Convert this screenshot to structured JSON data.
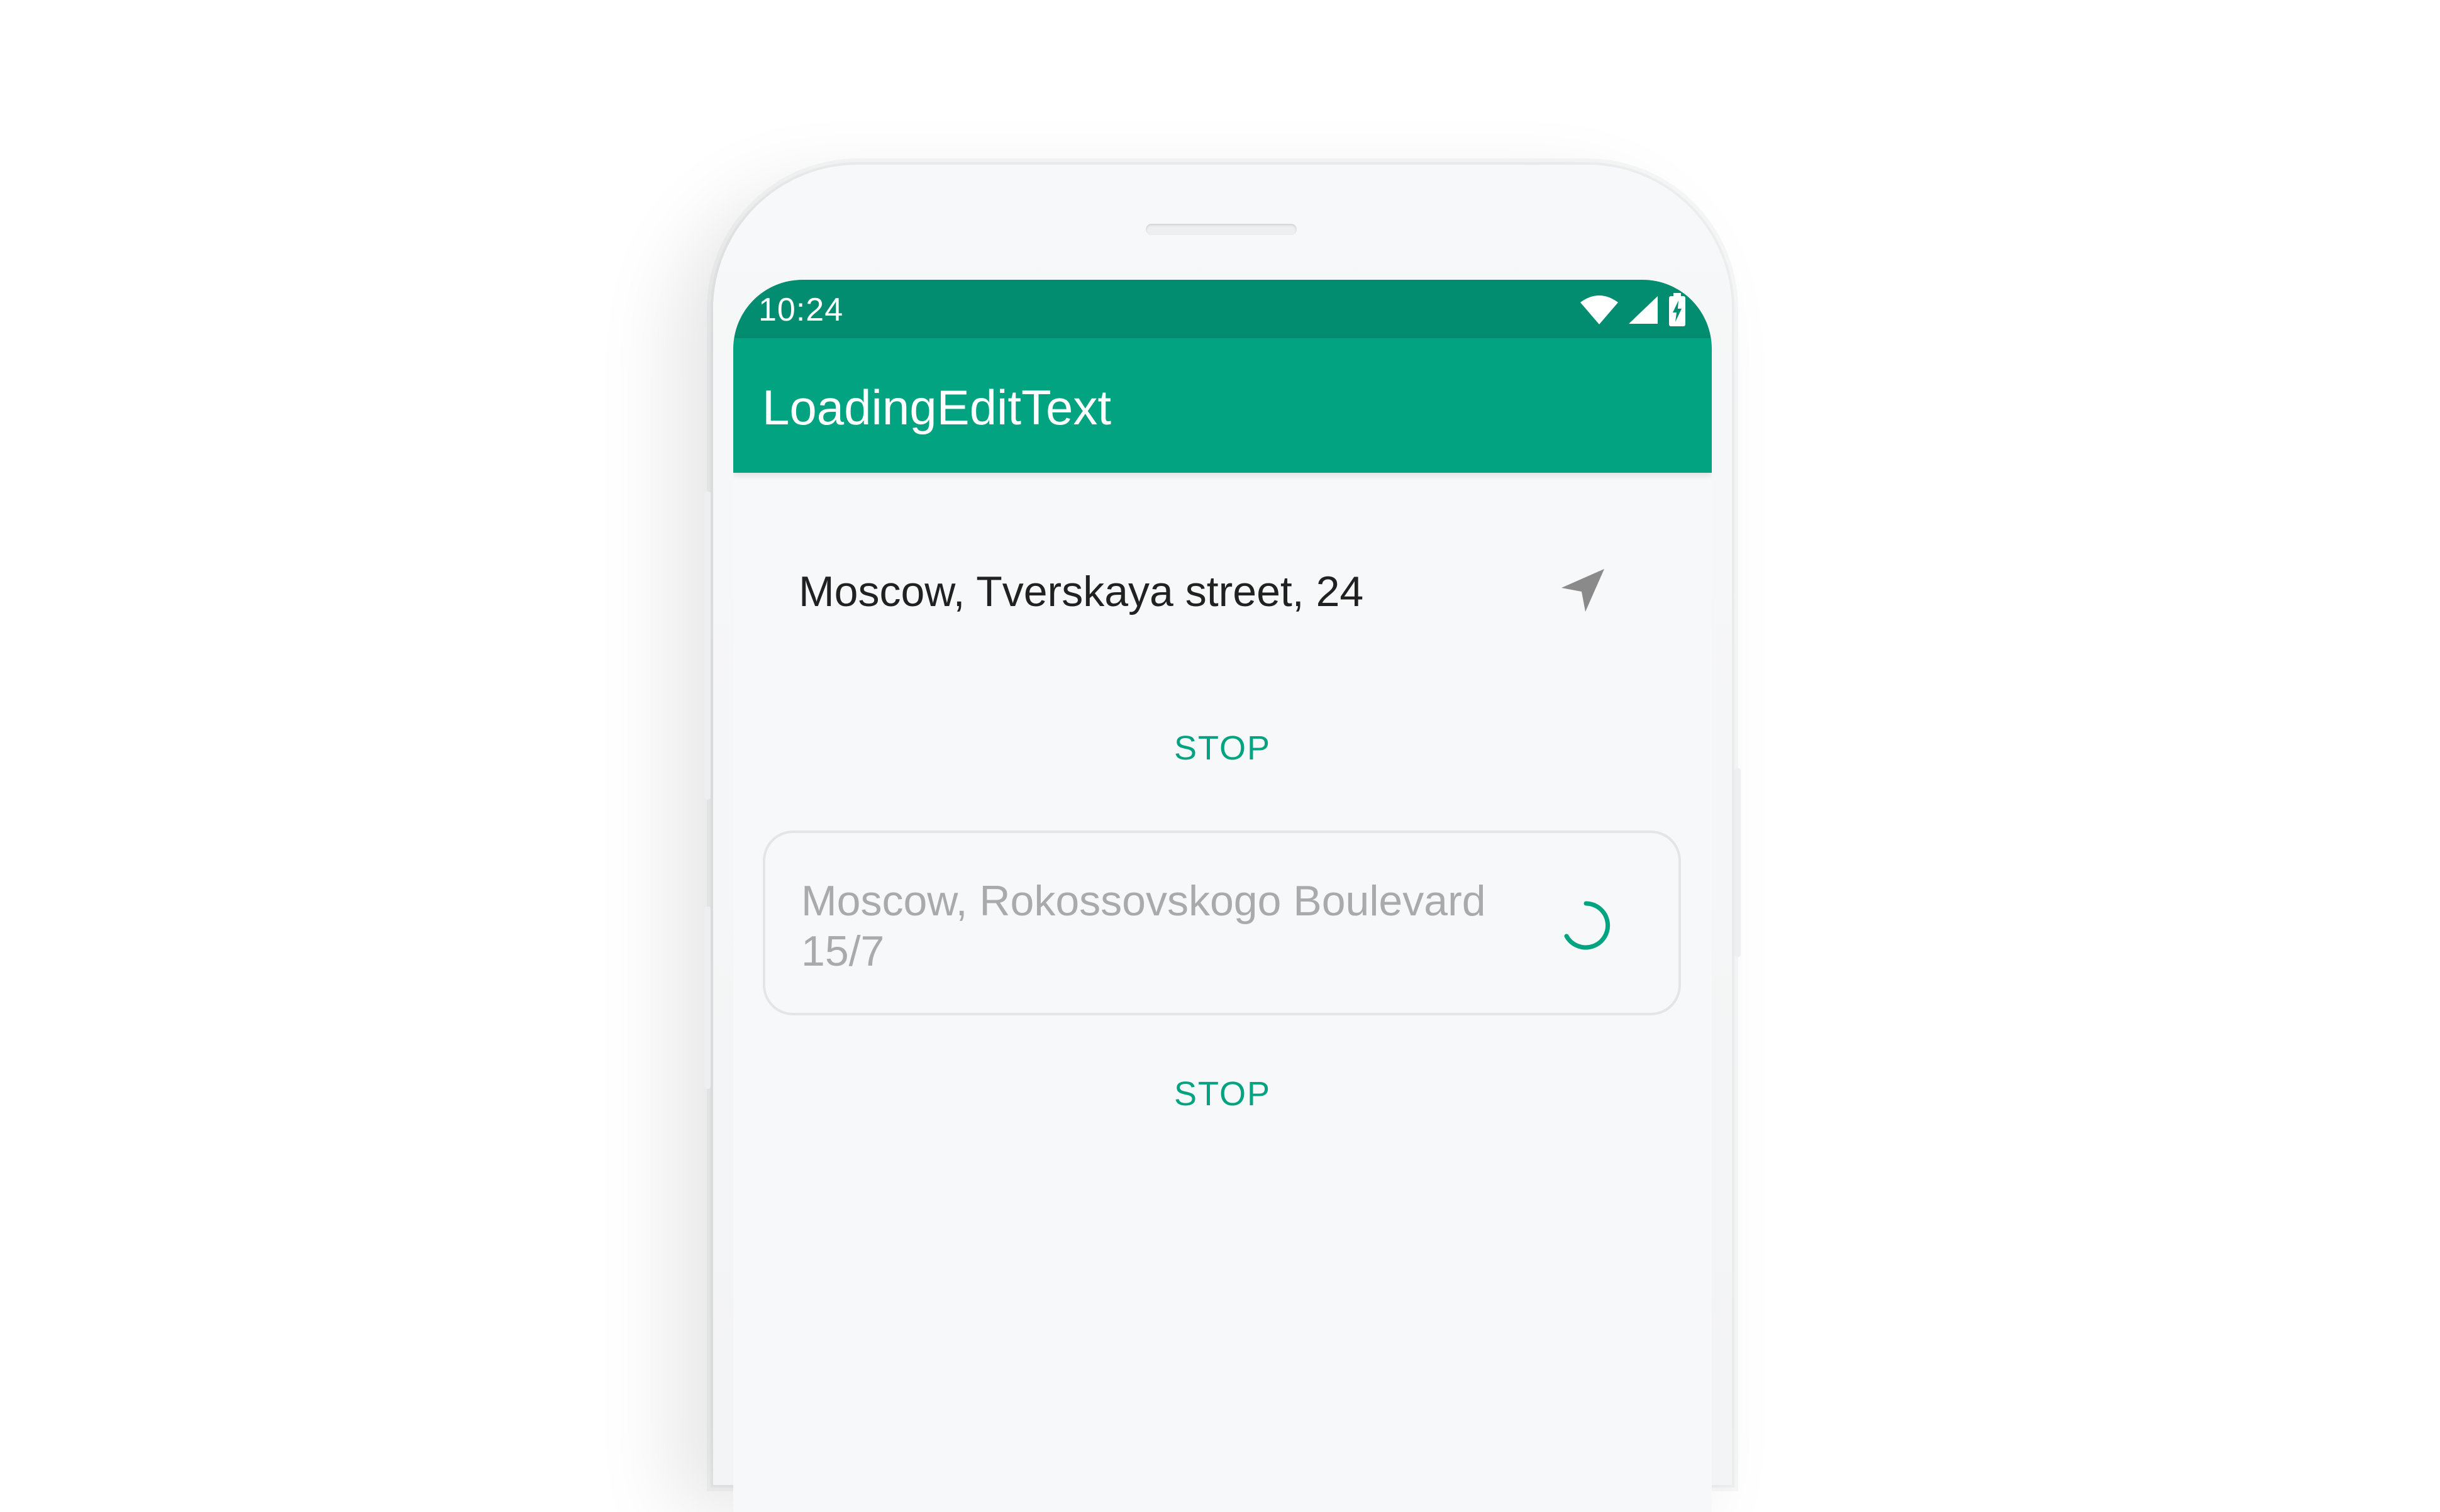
{
  "status_bar": {
    "time": "10:24",
    "icons": [
      "wifi-icon",
      "cellular-signal-icon",
      "battery-charging-icon"
    ]
  },
  "app_bar": {
    "title": "LoadingEditText"
  },
  "content": {
    "address_field": {
      "value": "Moscow, Tverskaya street, 24",
      "trailing_icon": "navigation-arrow-icon"
    },
    "stop_button_1": {
      "label": "STOP"
    },
    "loading_field": {
      "placeholder": "Moscow, Rokossovskogo Boulevard 15/7",
      "trailing_icon": "loading-spinner"
    },
    "stop_button_2": {
      "label": "STOP"
    }
  },
  "colors": {
    "status_bar": "#028c70",
    "app_bar": "#02a381",
    "accent": "#02a381",
    "text_primary": "#212121",
    "text_hint": "#a9aaab",
    "icon_gray": "#8a8a8a"
  }
}
